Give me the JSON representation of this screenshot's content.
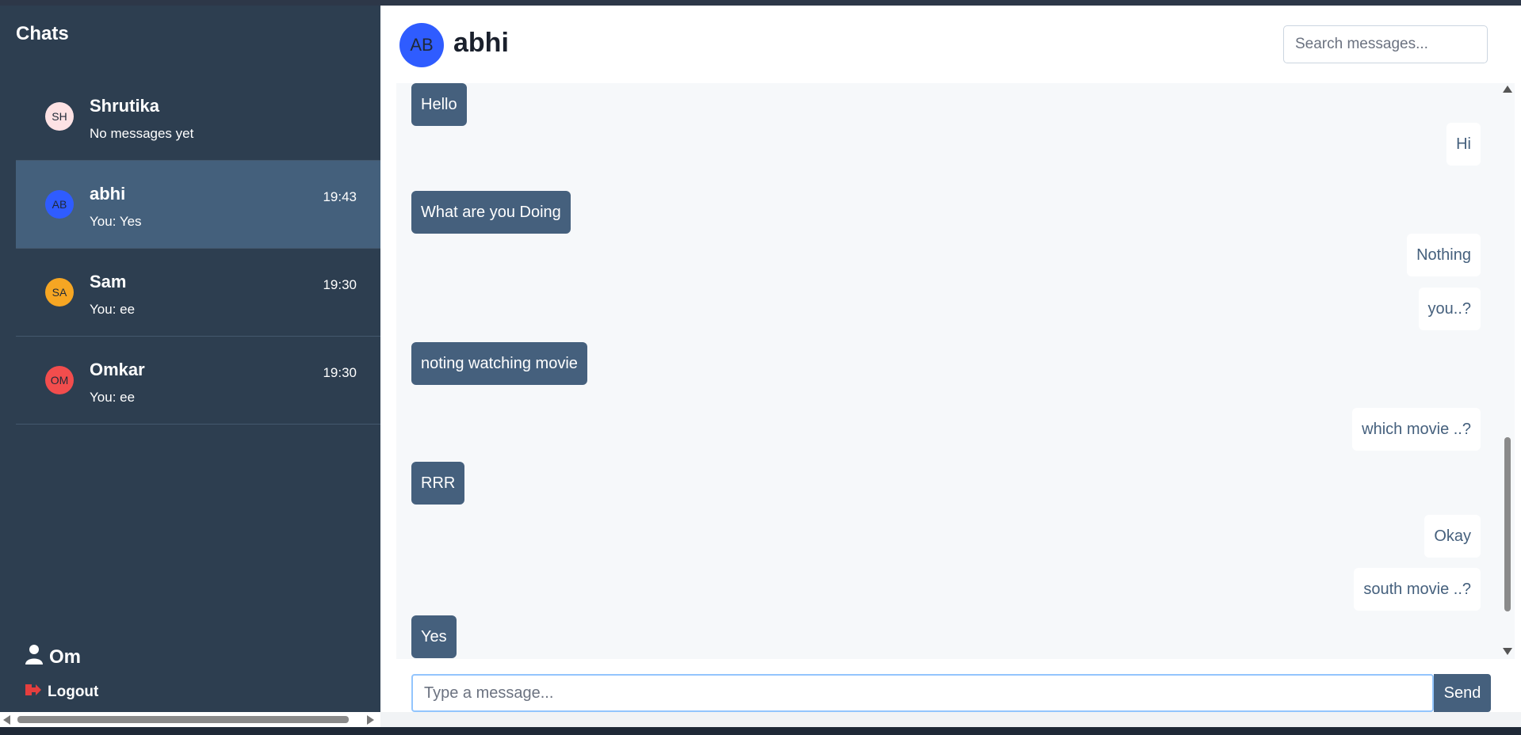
{
  "sidebar": {
    "title": "Chats",
    "chats": [
      {
        "initials": "SH",
        "name": "Shrutika",
        "preview": "No messages yet",
        "time": "",
        "avatar_color": "#fde2e4",
        "active": false
      },
      {
        "initials": "AB",
        "name": "abhi",
        "preview": "You: Yes",
        "time": "19:43",
        "avatar_color": "#2f5cff",
        "active": true
      },
      {
        "initials": "SA",
        "name": "Sam",
        "preview": "You: ee",
        "time": "19:30",
        "avatar_color": "#f6a623",
        "active": false
      },
      {
        "initials": "OM",
        "name": "Omkar",
        "preview": "You: ee",
        "time": "19:30",
        "avatar_color": "#f24d4d",
        "active": false
      }
    ],
    "user": {
      "name": "Om",
      "icon": "user-icon"
    },
    "logout": {
      "label": "Logout",
      "icon": "logout-icon",
      "icon_color": "#e53e3e"
    }
  },
  "header": {
    "initials": "AB",
    "name": "abhi",
    "avatar_color": "#2f5cff",
    "search_placeholder": "Search messages..."
  },
  "messages": [
    {
      "text": "Hello",
      "direction": "in"
    },
    {
      "text": "Hi",
      "direction": "out"
    },
    {
      "text": "What are you Doing",
      "direction": "in"
    },
    {
      "text": "Nothing",
      "direction": "out"
    },
    {
      "text": "you..?",
      "direction": "out"
    },
    {
      "text": "noting watching movie",
      "direction": "in"
    },
    {
      "text": "which movie ..?",
      "direction": "out"
    },
    {
      "text": "RRR",
      "direction": "in"
    },
    {
      "text": "Okay",
      "direction": "out"
    },
    {
      "text": "south movie ..?",
      "direction": "out"
    },
    {
      "text": "Yes",
      "direction": "in"
    }
  ],
  "composer": {
    "placeholder": "Type a message...",
    "send_label": "Send"
  },
  "colors": {
    "sidebar_bg": "#2d3e50",
    "active_chat_bg": "#44607c",
    "incoming_bubble": "#45607d",
    "outgoing_text": "#45607d",
    "messages_bg": "#f6f8fa"
  }
}
